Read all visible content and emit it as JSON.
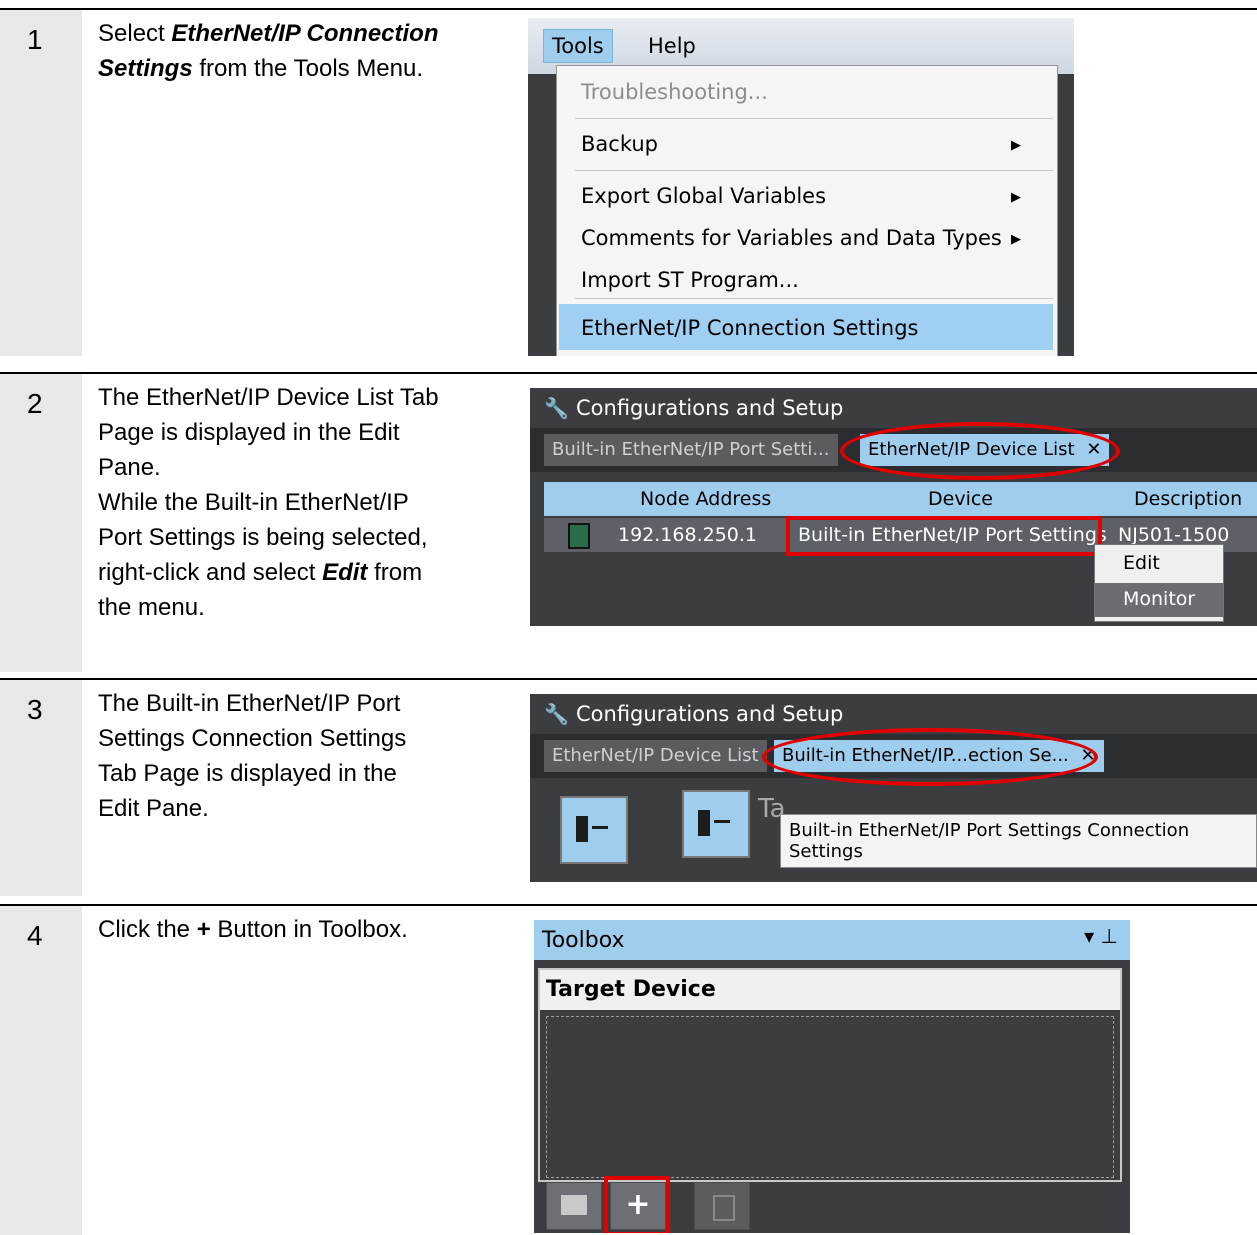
{
  "steps": [
    {
      "number": "1",
      "text_parts": [
        "Select ",
        "EtherNet/IP Connection Settings",
        " from the Tools Menu."
      ],
      "screenshot": {
        "menubar": [
          "Tools",
          "Help"
        ],
        "items": [
          {
            "label": "Troubleshooting...",
            "enabled": false,
            "submenu": false
          },
          {
            "label": "Backup",
            "enabled": true,
            "submenu": true
          },
          {
            "label": "Export Global Variables",
            "enabled": true,
            "submenu": true
          },
          {
            "label": "Comments for Variables and Data Types",
            "enabled": true,
            "submenu": true
          },
          {
            "label": "Import ST Program...",
            "enabled": true,
            "submenu": false
          },
          {
            "label": "EtherNet/IP Connection Settings",
            "enabled": true,
            "submenu": false,
            "highlighted": true
          }
        ]
      }
    },
    {
      "number": "2",
      "text_lines": [
        "The EtherNet/IP Device List Tab",
        "Page is displayed in the Edit",
        "Pane.",
        "While the Built-in EtherNet/IP",
        "Port Settings is being selected,"
      ],
      "text_last_parts": [
        "right-click and select ",
        "Edit",
        " from",
        "the menu."
      ],
      "screenshot": {
        "title": "Configurations and Setup",
        "tabs": [
          "Built-in EtherNet/IP Port Setti...",
          "EtherNet/IP Device List"
        ],
        "tab_close": "✕",
        "columns": [
          "Node Address",
          "Device",
          "Description"
        ],
        "row": {
          "node_address": "192.168.250.1",
          "device": "Built-in EtherNet/IP Port Settings",
          "description": "NJ501-1500"
        },
        "context_menu": [
          "Edit",
          "Monitor"
        ]
      }
    },
    {
      "number": "3",
      "text_lines": [
        "The Built-in EtherNet/IP Port",
        "Settings Connection Settings",
        "Tab Page is displayed in the",
        "Edit Pane."
      ],
      "screenshot": {
        "title": "Configurations and Setup",
        "tabs": [
          "EtherNet/IP Device List",
          "Built-in EtherNet/IP...ection Se..."
        ],
        "tab_close": "✕",
        "behind_text": "Ta",
        "tooltip": "Built-in EtherNet/IP Port Settings Connection Settings"
      }
    },
    {
      "number": "4",
      "text_parts": [
        "Click the ",
        "+",
        " Button in Toolbox."
      ],
      "screenshot": {
        "title": "Toolbox",
        "controls": "▾ ⊥",
        "panel_header": "Target Device",
        "add_button": "+"
      }
    }
  ],
  "colors": {
    "accent": "#9fcdee",
    "dark_bg": "#3b3d41",
    "highlight_red": "#e00000",
    "number_col": "#e8e8e8"
  }
}
